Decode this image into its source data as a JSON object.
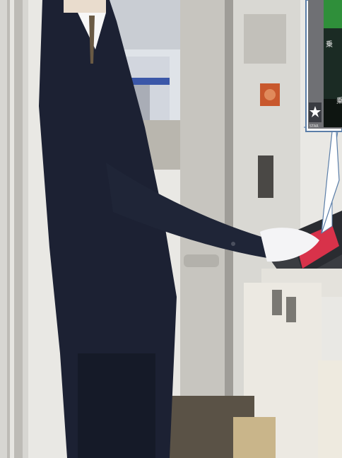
{
  "scene": {
    "description_tag": "train-conductor-operating-door-panel",
    "callout": {
      "text_row_1": "乗",
      "text_row_2": "乗",
      "logo_text": "STAR"
    },
    "colors": {
      "uniform": "#1c2133",
      "glove": "#f4f4f6",
      "door_frame": "#c9c7c2",
      "panel_screen_red": "#d8324a",
      "callout_border": "#5b7ea8",
      "screen_green": "#2f8f3a"
    }
  }
}
